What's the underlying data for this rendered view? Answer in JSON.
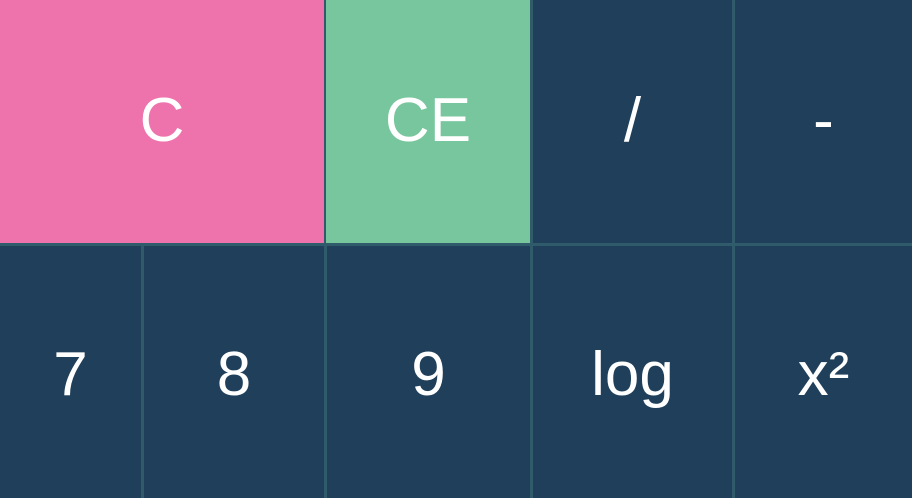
{
  "calculator": {
    "keys": {
      "clear": "C",
      "clear_entry": "CE",
      "divide": "/",
      "minus": "-",
      "seven": "7",
      "eight": "8",
      "nine": "9",
      "log": "log",
      "square": "x²"
    }
  },
  "colors": {
    "key_bg": "#1f3f5a",
    "clear_bg": "#ee73ac",
    "clear_entry_bg": "#78c69d",
    "grid_line": "#2f5b6b",
    "text": "#ffffff"
  }
}
